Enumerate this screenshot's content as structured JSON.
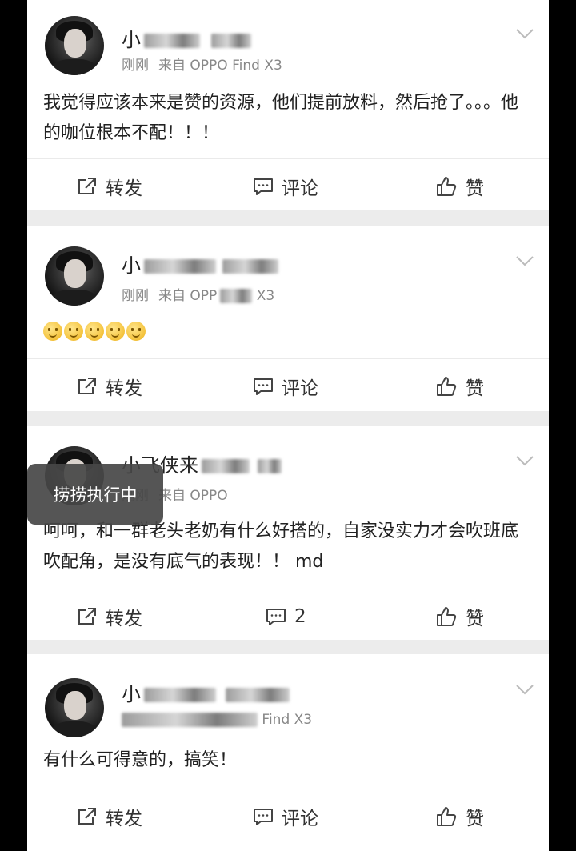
{
  "posts": [
    {
      "name": "小",
      "meta_time": "刚刚",
      "meta_source": "来自 OPPO Find X3",
      "content": "我觉得应该本来是赞的资源，他们提前放料，然后抢了。。。他的咖位根本不配！！！",
      "repost_label": "转发",
      "comment_label": "评论",
      "like_label": "赞"
    },
    {
      "name": "小",
      "meta_time": "刚刚",
      "meta_source": "来自 OPP",
      "meta_tail": "X3",
      "content": "",
      "repost_label": "转发",
      "comment_label": "评论",
      "like_label": "赞"
    },
    {
      "name": "小飞侠来",
      "meta_time": "刚刚",
      "meta_source": "来自 OPPO",
      "content": "呵呵，和一群老头老奶有什么好搭的，自家没实力才会吹班底吹配角，是没有底气的表现！！ md",
      "repost_label": "转发",
      "comment_label": "2",
      "like_label": "赞"
    },
    {
      "name": "小",
      "meta_time": "",
      "meta_source": "Find X3",
      "content": "有什么可得意的，搞笑！",
      "repost_label": "转发",
      "comment_label": "评论",
      "like_label": "赞"
    }
  ],
  "toast": "捞捞执行中",
  "icons": {
    "repost": "repost-icon",
    "comment": "comment-icon",
    "like": "thumbs-up-icon",
    "more": "chevron-down-icon"
  },
  "colors": {
    "background": "#ececec",
    "card": "#ffffff",
    "text": "#222222",
    "meta": "#888888"
  }
}
